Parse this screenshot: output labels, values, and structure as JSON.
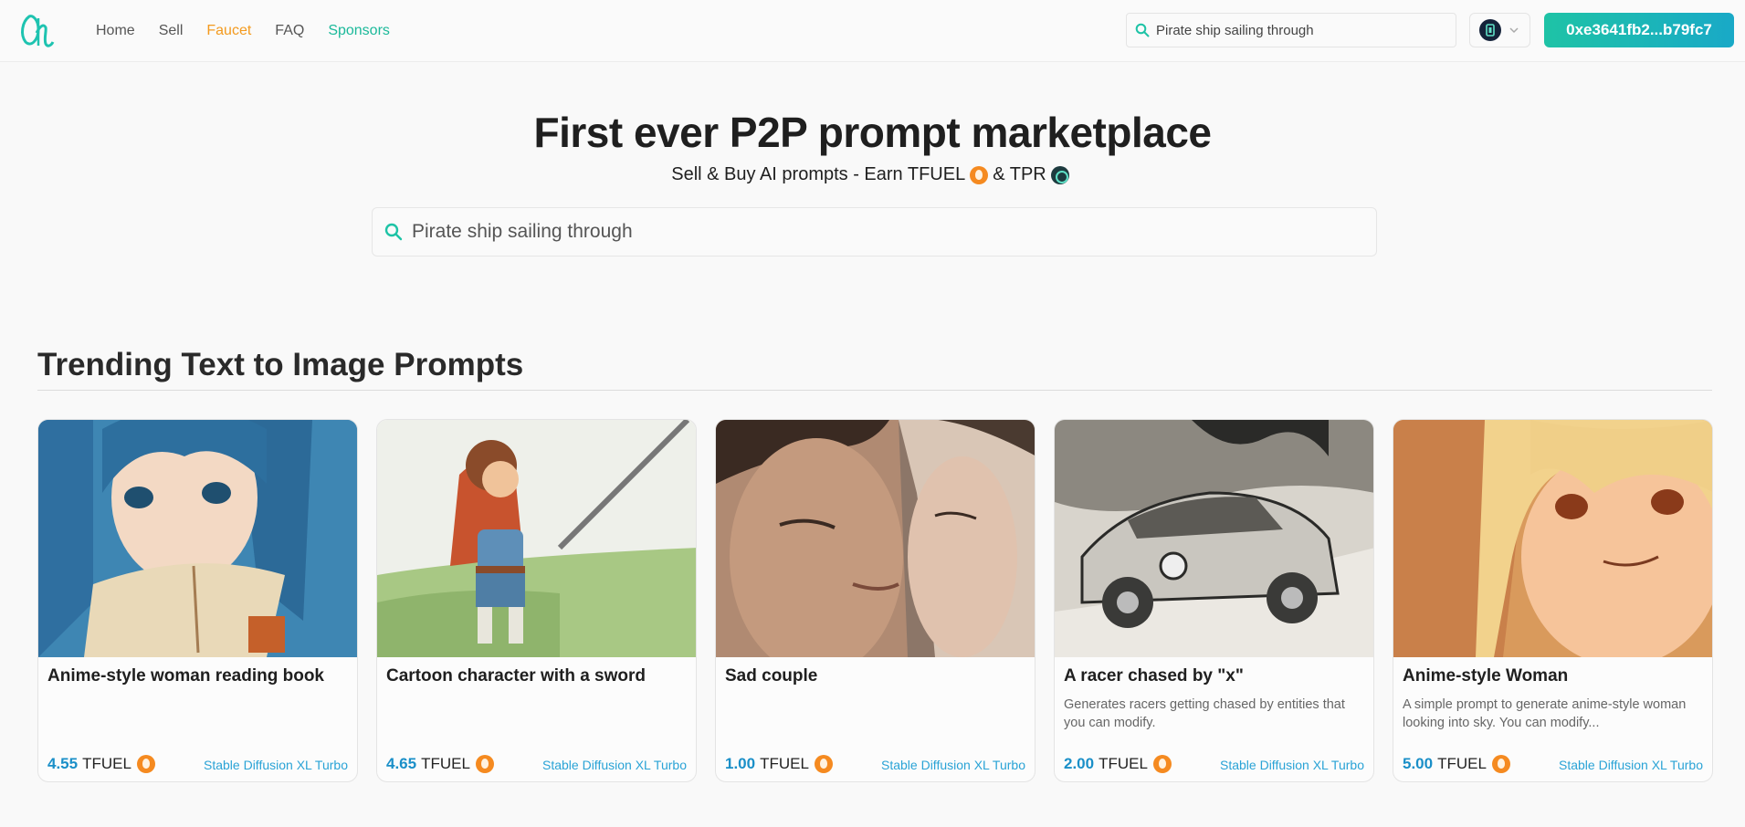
{
  "nav": {
    "home": "Home",
    "sell": "Sell",
    "faucet": "Faucet",
    "faq": "FAQ",
    "sponsors": "Sponsors"
  },
  "header_search": {
    "value": "Pirate ship sailing through"
  },
  "wallet": {
    "address": "0xe3641fb2...b79fc7"
  },
  "hero": {
    "title": "First ever P2P prompt marketplace",
    "subtitle_part1": "Sell & Buy AI prompts - Earn TFUEL",
    "subtitle_part2": "& TPR",
    "search_value": "Pirate ship sailing through"
  },
  "section": {
    "title": "Trending Text to Image Prompts"
  },
  "cards": [
    {
      "title": "Anime-style woman reading book",
      "description": "",
      "price": "4.55",
      "currency": "TFUEL",
      "model": "Stable Diffusion XL Turbo"
    },
    {
      "title": "Cartoon character with a sword",
      "description": "",
      "price": "4.65",
      "currency": "TFUEL",
      "model": "Stable Diffusion XL Turbo"
    },
    {
      "title": "Sad couple",
      "description": "",
      "price": "1.00",
      "currency": "TFUEL",
      "model": "Stable Diffusion XL Turbo"
    },
    {
      "title": "A racer chased by \"x\"",
      "description": "Generates racers getting chased by entities that you can modify.",
      "price": "2.00",
      "currency": "TFUEL",
      "model": "Stable Diffusion XL Turbo"
    },
    {
      "title": "Anime-style Woman",
      "description": "A simple prompt to generate anime-style woman looking into sky. You can modify...",
      "price": "5.00",
      "currency": "TFUEL",
      "model": "Stable Diffusion XL Turbo"
    }
  ],
  "colors": {
    "accent_teal": "#1ec3a6",
    "faucet_orange": "#f39a1e",
    "price_blue": "#1a8fc8"
  }
}
